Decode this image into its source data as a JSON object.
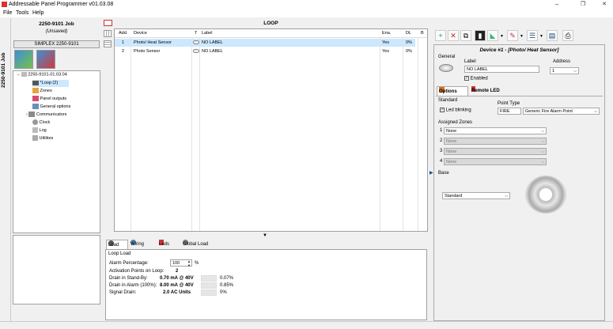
{
  "window": {
    "title": "Addressable Panel Programmer v01.03.08",
    "min": "–",
    "max": "❐",
    "close": "✕"
  },
  "menu": [
    "File",
    "Tools",
    "Help"
  ],
  "left": {
    "vertical_title": "2250-9101 Job",
    "job_name": "2250-9101 Job",
    "job_state": "(Unsaved)",
    "panel_label": "SIMPLEX  2250-9101",
    "tree": {
      "root": "2250-9101-01.03.04",
      "items": [
        "*Loop (2)",
        "Zones",
        "Panel outputs",
        "General options",
        "Communicators",
        "Clock",
        "Log",
        "Utilities"
      ]
    }
  },
  "loop": {
    "title": "LOOP",
    "columns": [
      "Add.",
      "Device",
      "T",
      "Label",
      "Ena.",
      "DL",
      "B"
    ],
    "rows": [
      {
        "add": "1",
        "device": "Photo/ Heat Sensor",
        "label": "NO LABEL",
        "ena": "Yes",
        "dl": "0%"
      },
      {
        "add": "2",
        "device": "Photo Sensor",
        "label": "NO LABEL",
        "ena": "Yes",
        "dl": "0%"
      }
    ]
  },
  "bottom": {
    "tabs": [
      "Load",
      "Wiring",
      "Leds",
      "Global Load"
    ],
    "section": "Loop Load",
    "alarm_pct_label": "Alarm Percentage:",
    "alarm_pct_value": "100",
    "alarm_pct_unit": "%",
    "activation_label": "Activation Points on Loop:",
    "activation_value": "2",
    "standby_label": "Drain in Stand-By:",
    "standby_value": "0.70 mA @ 40V",
    "standby_pct": "0.07%",
    "alarm_label": "Drain in Alarm (100%):",
    "alarm_value": "8.00 mA @ 40V",
    "alarm_pct": "0.85%",
    "signal_label": "Signal Drain:",
    "signal_value": "2.0 AC Units",
    "signal_pct": "0%"
  },
  "right": {
    "device_title": "Device #1 - [Photo/ Heat Sensor]",
    "general": "General",
    "label_caption": "Label",
    "label_value": "NO LABEL",
    "address_caption": "Address",
    "address_value": "1",
    "enabled": "Enabled",
    "tabs": [
      "Options",
      "Remote LED"
    ],
    "standard": "Standard",
    "led_blinking": "Led blinking",
    "point_type_caption": "Point Type",
    "point_type_code": "FIRE",
    "point_type_value": "Generic Fire Alarm Point",
    "assigned_zones": "Assigned Zones",
    "zones": [
      {
        "n": "1",
        "v": "None"
      },
      {
        "n": "2",
        "v": "None"
      },
      {
        "n": "3",
        "v": "None"
      },
      {
        "n": "4",
        "v": "None"
      }
    ],
    "base": "Base",
    "base_value": "Standard"
  },
  "colors": {
    "accent": "#0078d7",
    "selected_row": "#cce8ff"
  }
}
